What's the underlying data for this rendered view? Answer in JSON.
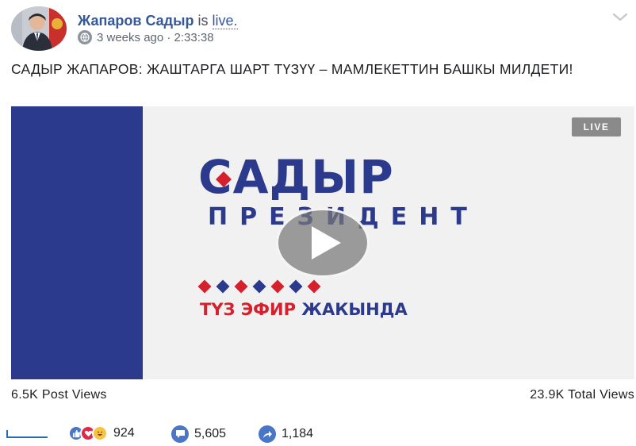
{
  "post": {
    "author_name": "Жапаров Садыр",
    "status_verb": "is",
    "status_link": "live.",
    "timestamp": "3 weeks ago · 2:33:38",
    "text": "САДЫР ЖАПАРОВ: ЖАШТАРГА ШАРТ ТҮЗҮҮ – МАМЛЕКЕТТИН БАШКЫ МИЛДЕТИ!"
  },
  "video": {
    "live_badge": "LIVE",
    "brand_title": "САДЫР",
    "brand_subtitle": "ПРЕЗИДЕНТ",
    "coming_red": "ТҮЗ ЭФИР",
    "coming_blue": "ЖАКЫНДА",
    "diamond_colors": [
      "#d5202e",
      "#2b3a8c",
      "#d5202e",
      "#2b3a8c",
      "#d5202e",
      "#2b3a8c",
      "#d5202e"
    ],
    "brand_color": "#2b3a8c",
    "accent_color": "#d5202e"
  },
  "stats": {
    "post_views": "6.5K Post Views",
    "total_views": "23.9K Total Views"
  },
  "reactions": {
    "reaction_count": "924",
    "comment_count": "5,605",
    "share_count": "1,184",
    "icons": [
      "like-icon",
      "love-icon",
      "haha-icon",
      "comment-icon",
      "share-icon"
    ]
  }
}
